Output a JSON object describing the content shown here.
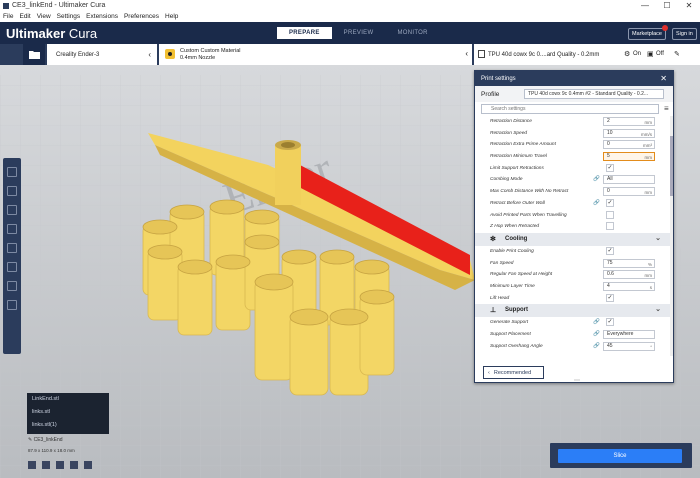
{
  "window": {
    "title": "CE3_linkEnd - Ultimaker Cura",
    "min": "—",
    "max": "☐",
    "close": "✕"
  },
  "menu": [
    "File",
    "Edit",
    "View",
    "Settings",
    "Extensions",
    "Preferences",
    "Help"
  ],
  "header": {
    "brand_bold": "Ultimaker",
    "brand_thin": "Cura",
    "stages": [
      "PREPARE",
      "PREVIEW",
      "MONITOR"
    ],
    "active_stage": "PREPARE",
    "marketplace": "Marketplace",
    "signin": "Sign in"
  },
  "jobbar": {
    "printer": "Creality Ender-3",
    "material_line1": "Custom Custom Material",
    "material_line2": "0.4mm Nozzle",
    "profile": "TPU 40d cowx 9c 0....ard Quality - 0.2mm",
    "support": "On",
    "adhesion": "Off"
  },
  "settings": {
    "panel_title": "Print settings",
    "profile_label": "Profile",
    "profile_value": "TPU 40d cowx 9c 0.4mm #2 - Standard Quality - 0.2...",
    "search_placeholder": "Search settings",
    "rows": [
      {
        "label": "Retraction Distance",
        "value": "2",
        "unit": "mm"
      },
      {
        "label": "Retraction Speed",
        "value": "10",
        "unit": "mm/s"
      },
      {
        "label": "Retraction Extra Prime Amount",
        "value": "0",
        "unit": "mm³"
      },
      {
        "label": "Retraction Minimum Travel",
        "value": "5",
        "unit": "mm"
      },
      {
        "label": "Limit Support Retractions",
        "check": "✓"
      },
      {
        "label": "Combing Mode",
        "select": "All"
      },
      {
        "label": "Max Comb Distance With No Retract",
        "value": "0",
        "unit": "mm"
      },
      {
        "label": "Retract Before Outer Wall",
        "check": "✓"
      },
      {
        "label": "Avoid Printed Parts When Travelling",
        "check": ""
      },
      {
        "label": "Z Hop When Retracted",
        "check": ""
      }
    ],
    "cat_cooling": "Cooling",
    "cooling_rows": [
      {
        "label": "Enable Print Cooling",
        "check": "✓"
      },
      {
        "label": "Fan Speed",
        "value": "75",
        "unit": "%"
      },
      {
        "label": "Regular Fan Speed at Height",
        "value": "0.6",
        "unit": "mm"
      },
      {
        "label": "Minimum Layer Time",
        "value": "4",
        "unit": "s"
      },
      {
        "label": "Lift Head",
        "check": "✓"
      }
    ],
    "cat_support": "Support",
    "support_rows": [
      {
        "label": "Generate Support",
        "check": "✓"
      },
      {
        "label": "Support Placement",
        "select": "Everywhere"
      },
      {
        "label": "Support Overhang Angle",
        "value": "45",
        "unit": "°"
      }
    ],
    "recommended": "Recommended"
  },
  "objects": {
    "list": [
      "LinkEnd.stl",
      "links.stl",
      "links.stl(1)"
    ],
    "status": "CE3_linkEnd",
    "dims": "87.9 x 110.9 x 18.0 mm"
  },
  "slice": "Slice"
}
